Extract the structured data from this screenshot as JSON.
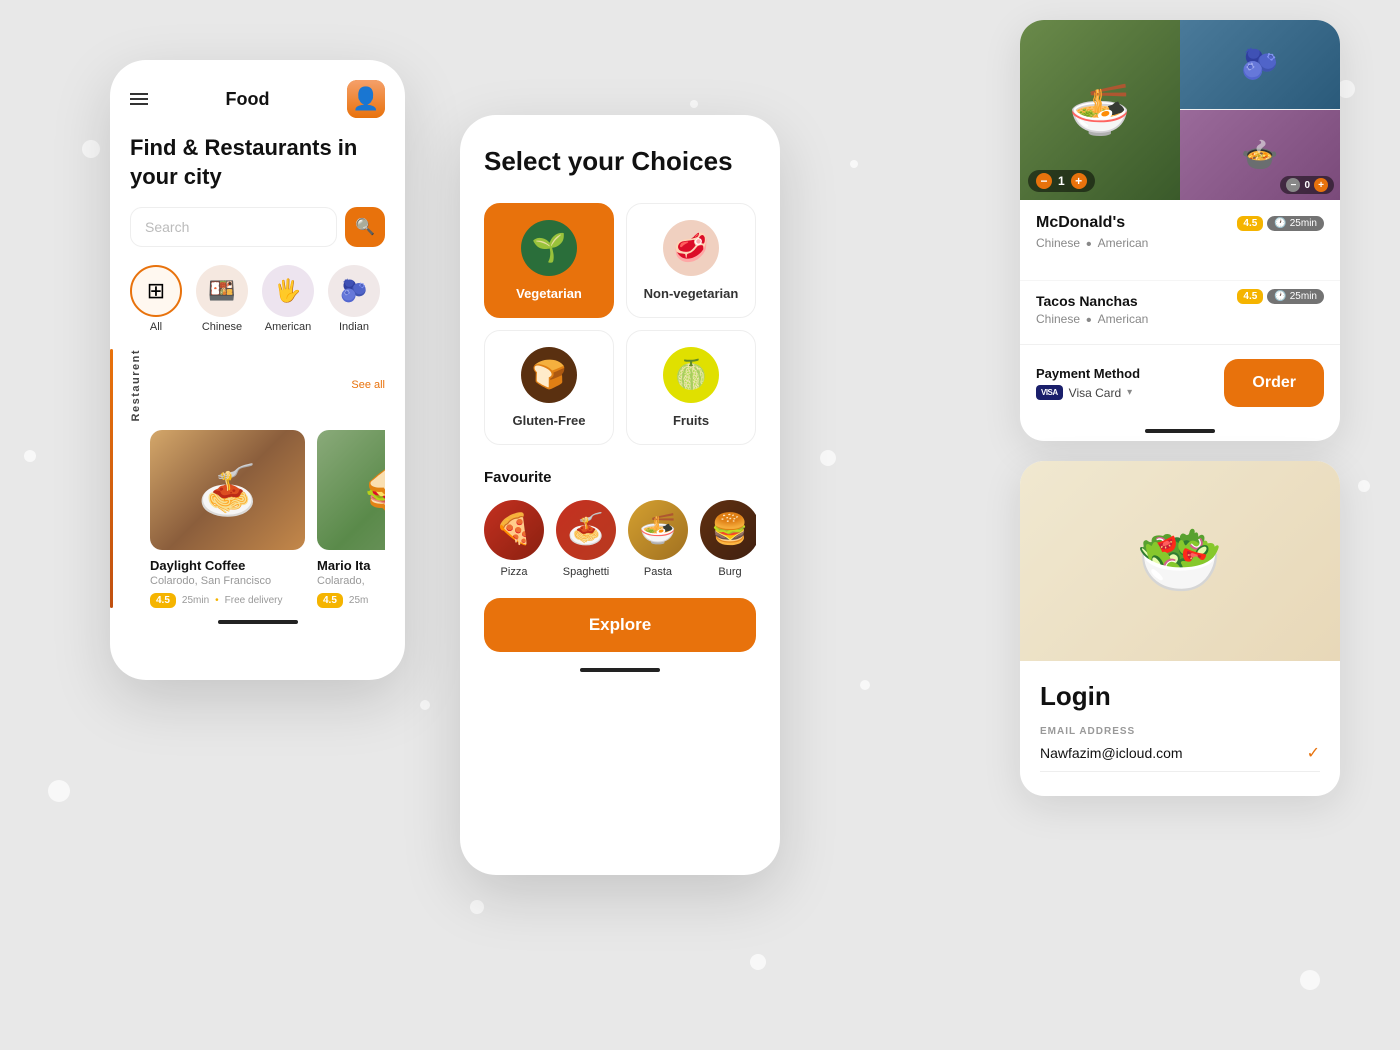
{
  "background": {
    "color": "#e8e8e8"
  },
  "phone1": {
    "title": "Food",
    "tagline": "Find & Restaurants in your city",
    "search_placeholder": "Search",
    "see_all": "See all",
    "categories": [
      {
        "label": "All",
        "icon": "⊞",
        "type": "all"
      },
      {
        "label": "Chinese",
        "icon": "🍱",
        "type": "chinese"
      },
      {
        "label": "American",
        "icon": "🖐",
        "type": "american"
      },
      {
        "label": "Indian",
        "icon": "🫐",
        "type": "indian"
      }
    ],
    "restaurants": [
      {
        "name": "Daylight Coffee",
        "location": "Colarodo, San Francisco",
        "rating": "4.5",
        "time": "25min",
        "delivery": "Free delivery",
        "img": "1"
      },
      {
        "name": "Mario Ita",
        "location": "Colarado,",
        "rating": "4.5",
        "time": "25m",
        "delivery": "",
        "img": "2"
      }
    ],
    "section_label": "Restaurent"
  },
  "phone2": {
    "title": "Select your Choices",
    "choices": [
      {
        "label": "Vegetarian",
        "icon": "🌱",
        "active": true,
        "icon_bg": "veg"
      },
      {
        "label": "Non-vegetarian",
        "icon": "🥩",
        "active": false,
        "icon_bg": "non-veg"
      },
      {
        "label": "Gluten-Free",
        "icon": "🍞",
        "active": false,
        "icon_bg": "gluten"
      },
      {
        "label": "Fruits",
        "icon": "🍈",
        "active": false,
        "icon_bg": "fruits"
      }
    ],
    "favourite_section_title": "Favourite",
    "favourites": [
      {
        "label": "Pizza",
        "icon": "🍕",
        "type": "pizza"
      },
      {
        "label": "Spaghetti",
        "icon": "🍝",
        "type": "spaghetti"
      },
      {
        "label": "Pasta",
        "icon": "🍝",
        "type": "pasta"
      },
      {
        "label": "Burg",
        "icon": "🍔",
        "type": "burger"
      }
    ],
    "explore_btn": "Explore"
  },
  "order_card": {
    "restaurant_name": "McDonald's",
    "tags": [
      "Chinese",
      "American"
    ],
    "qty_left": "1",
    "qty_right": "0",
    "second_restaurant": "Tacos Nanchas",
    "second_tags": [
      "Chinese",
      "American"
    ],
    "second_rating": "4.5",
    "second_time": "25min",
    "rating": "4.5",
    "time": "25min",
    "payment_method_label": "Payment Method",
    "payment_method_value": "Visa Card",
    "order_btn": "Order"
  },
  "login_card": {
    "title": "Login",
    "email_label": "EMAIL ADDRESS",
    "email_value": "Nawfazim@icloud.com"
  }
}
